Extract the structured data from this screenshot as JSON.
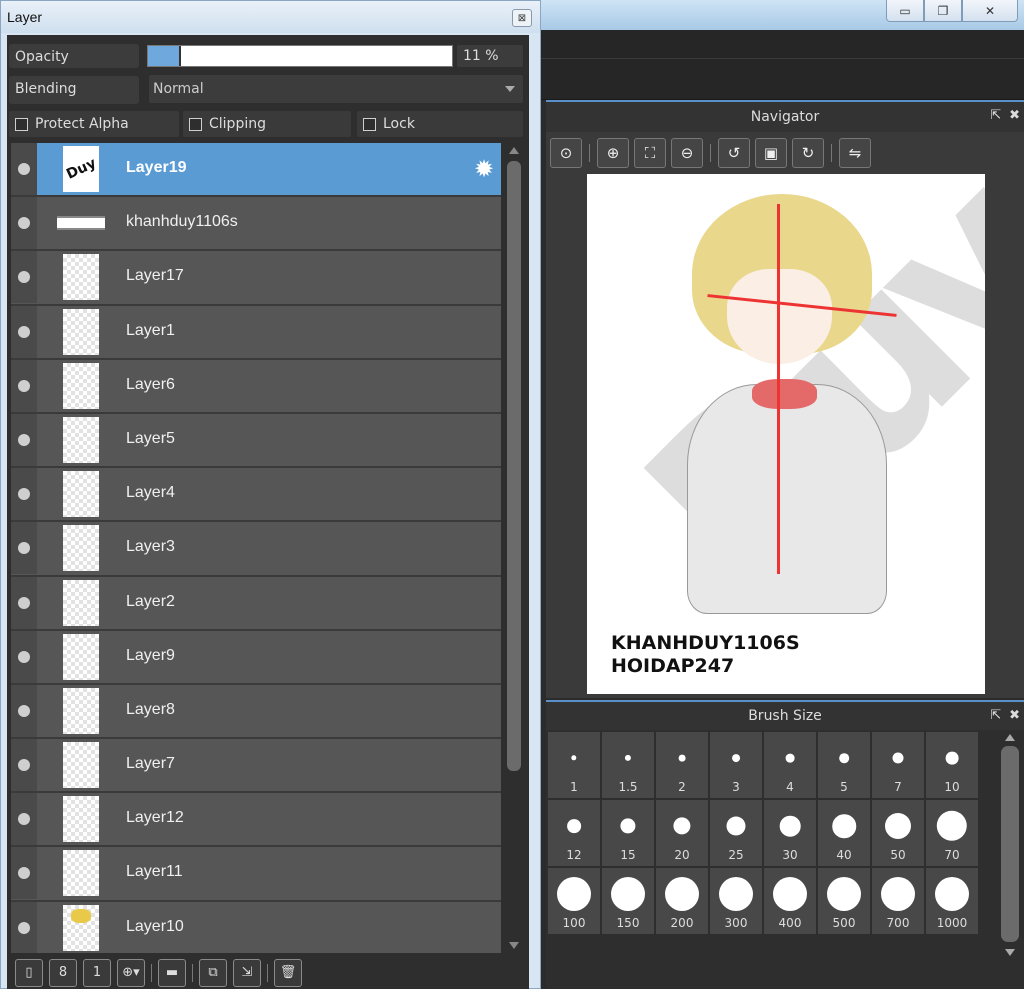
{
  "window_controls": {
    "minimize": "▭",
    "restore": "❐",
    "close": "✕"
  },
  "layer_panel": {
    "title": "Layer",
    "opacity": {
      "label": "Opacity",
      "value_text": "11 %",
      "value": 0.11
    },
    "blending": {
      "label": "Blending",
      "value": "Normal"
    },
    "checks": {
      "protect_alpha": "Protect Alpha",
      "clipping": "Clipping",
      "lock": "Lock"
    },
    "layers": [
      {
        "name": "Layer19",
        "selected": true
      },
      {
        "name": "khanhduy1106s"
      },
      {
        "name": "Layer17"
      },
      {
        "name": "Layer1"
      },
      {
        "name": "Layer6"
      },
      {
        "name": "Layer5"
      },
      {
        "name": "Layer4"
      },
      {
        "name": "Layer3"
      },
      {
        "name": "Layer2"
      },
      {
        "name": "Layer9"
      },
      {
        "name": "Layer8"
      },
      {
        "name": "Layer7"
      },
      {
        "name": "Layer12"
      },
      {
        "name": "Layer11"
      },
      {
        "name": "Layer10"
      }
    ],
    "thumb_text": "Duy",
    "toolbar": [
      "new-layer",
      "new-8bit-layer",
      "new-1bit-layer",
      "add-layer-menu",
      "new-folder",
      "duplicate-layer",
      "merge-down",
      "delete-layer"
    ],
    "toolbar_glyphs": {
      "new-layer": "▯",
      "new-8bit-layer": "8",
      "new-1bit-layer": "1",
      "add-layer-menu": "⊕▾",
      "new-folder": "▬",
      "duplicate-layer": "⧉",
      "merge-down": "⇲",
      "delete-layer": "🗑"
    }
  },
  "navigator": {
    "title": "Navigator",
    "tools": [
      "zoom-actual",
      "zoom-in",
      "fit-window",
      "zoom-out",
      "rotate-left",
      "fit-canvas",
      "rotate-right",
      "flip-horizontal"
    ],
    "tool_glyphs": {
      "zoom-actual": "⊙",
      "zoom-in": "⊕",
      "fit-window": "⛶",
      "zoom-out": "⊖",
      "rotate-left": "↺",
      "fit-canvas": "▣",
      "rotate-right": "↻",
      "flip-horizontal": "⇋"
    },
    "canvas_caption_line1": "KHANHDUY1106S",
    "canvas_caption_line2": "HOIDAP247",
    "watermark": "Duy"
  },
  "brush_size": {
    "title": "Brush Size",
    "sizes": [
      "1",
      "1.5",
      "2",
      "3",
      "4",
      "5",
      "7",
      "10",
      "12",
      "15",
      "20",
      "25",
      "30",
      "40",
      "50",
      "70",
      "100",
      "150",
      "200",
      "300",
      "400",
      "500",
      "700",
      "1000"
    ]
  },
  "panel_icons": {
    "popout": "⇱",
    "close": "✖"
  },
  "colors": {
    "selection": "#5a9bd4",
    "accent": "#5a90c8"
  }
}
